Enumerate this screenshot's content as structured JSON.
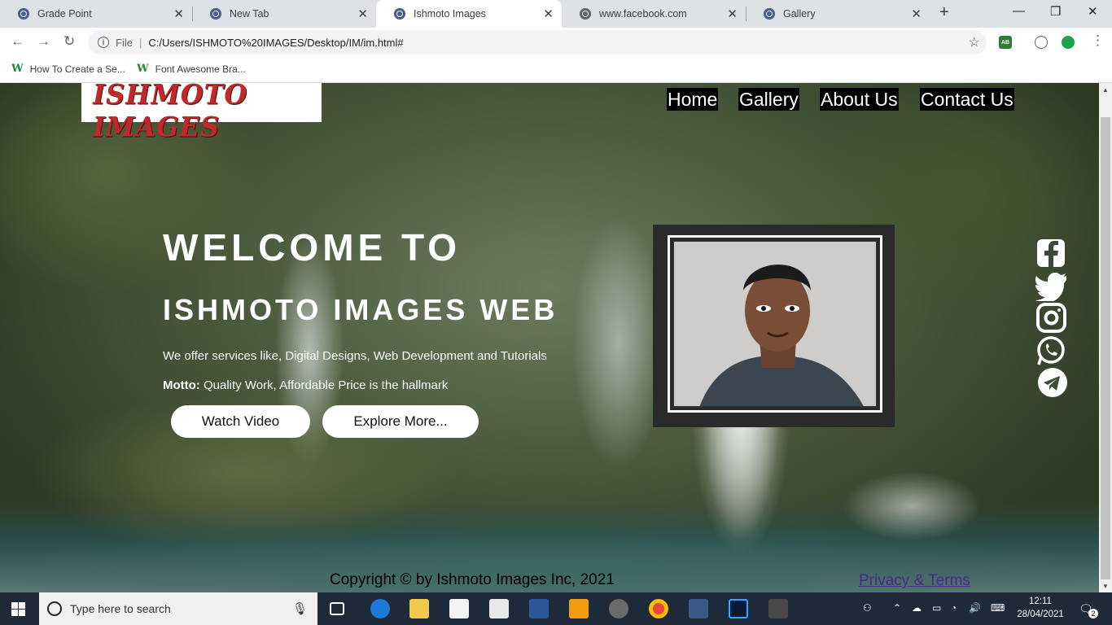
{
  "browser": {
    "tabs": [
      {
        "label": "Grade Point",
        "active": false
      },
      {
        "label": "New Tab",
        "active": false
      },
      {
        "label": "Ishmoto Images",
        "active": true
      },
      {
        "label": "www.facebook.com",
        "active": false
      },
      {
        "label": "Gallery",
        "active": false
      }
    ],
    "address": {
      "scheme_label": "File",
      "url": "C:/Users/ISHMOTO%20IMAGES/Desktop/IM/im.html#"
    },
    "bookmarks": [
      {
        "label": "How To Create a Se..."
      },
      {
        "label": "Font Awesome Bra..."
      }
    ],
    "extensions": {
      "adblock": "AB"
    }
  },
  "site": {
    "logo_text": "ISHMOTO IMAGES",
    "nav": [
      "Home",
      "Gallery",
      "About Us",
      "Contact Us"
    ],
    "hero": {
      "welcome": "WELCOME TO",
      "subheading": "ISHMOTO IMAGES WEB",
      "description": "We offer services like, Digital Designs, Web Development and Tutorials",
      "motto_label": "Motto:",
      "motto_text": " Quality Work, Affordable Price is the hallmark",
      "buttons": [
        "Watch Video",
        "Explore More..."
      ]
    },
    "social_icons": [
      "facebook-icon",
      "twitter-icon",
      "instagram-icon",
      "whatsapp-icon",
      "telegram-icon"
    ],
    "footer": {
      "copyright": "Copyright © by Ishmoto Images Inc, 2021",
      "privacy_link": "Privacy & Terms"
    }
  },
  "taskbar": {
    "search_placeholder": "Type here to search",
    "time": "12:11",
    "date": "28/04/2021",
    "notification_count": "2"
  },
  "colors": {
    "nav_bg": "#000000",
    "logo_red": "#c0282b",
    "taskbar_bg": "#1c2a3a",
    "link_purple": "#4b2a8a"
  }
}
